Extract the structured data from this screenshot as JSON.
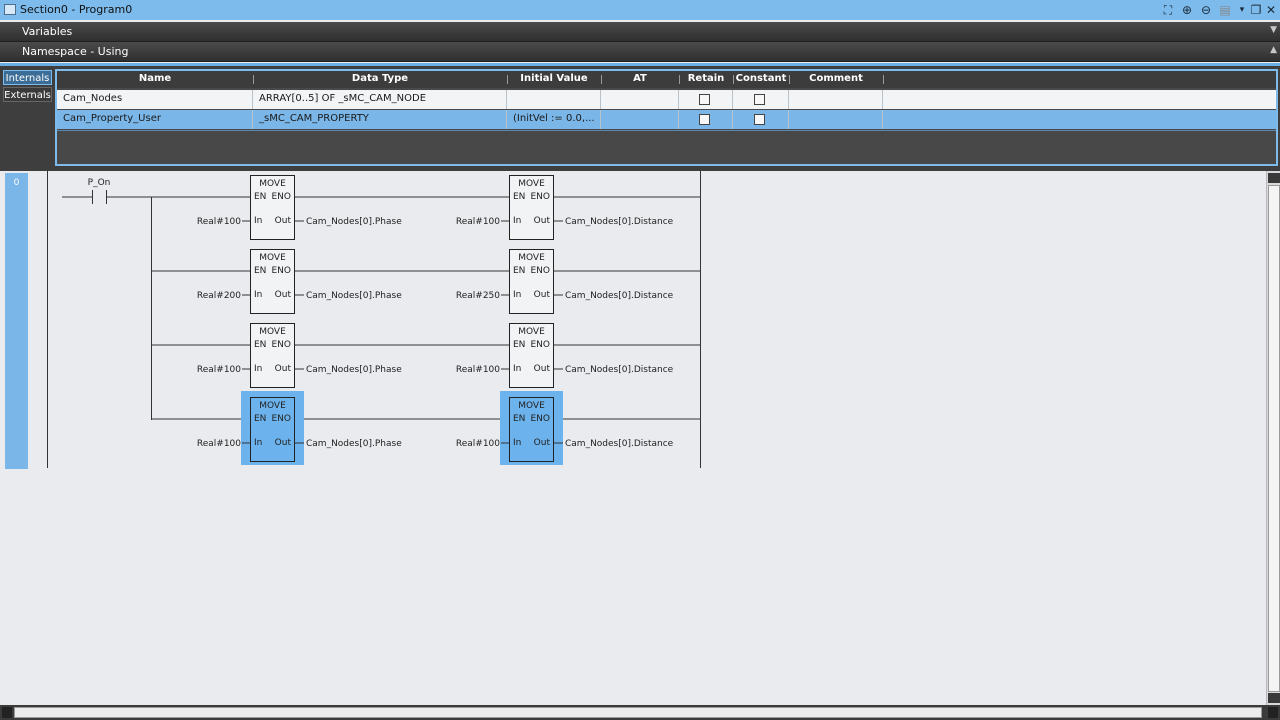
{
  "window": {
    "title": "Section0 - Program0",
    "buttons": {
      "fit": "⛶",
      "zoom_in": "⊕",
      "zoom_out": "⊖",
      "menu": "▾",
      "restore": "❐",
      "close": "✕"
    }
  },
  "variables_header": {
    "label": "Variables",
    "caret": "▼"
  },
  "namespace_header": {
    "label": "Namespace - Using",
    "caret": "▲"
  },
  "side_tabs": {
    "internals": "Internals",
    "externals": "Externals"
  },
  "columns": {
    "name": "Name",
    "data_type": "Data Type",
    "initial_value": "Initial Value",
    "at": "AT",
    "retain": "Retain",
    "constant": "Constant",
    "comment": "Comment"
  },
  "rows": [
    {
      "name": "Cam_Nodes",
      "data_type": "ARRAY[0..5] OF _sMC_CAM_NODE",
      "initial_value": "",
      "at": "",
      "retain": false,
      "constant": false,
      "comment": "",
      "selected": false
    },
    {
      "name": "Cam_Property_User",
      "data_type": "_sMC_CAM_PROPERTY",
      "initial_value": "(InitVel := 0.0,...",
      "at": "",
      "retain": false,
      "constant": false,
      "comment": "",
      "selected": true
    }
  ],
  "ladder": {
    "rung_number": "0",
    "contact_label": "P_On",
    "block_name": "MOVE",
    "pin_en": "EN",
    "pin_eno": "ENO",
    "pin_in": "In",
    "pin_out": "Out",
    "rows": [
      {
        "left_in": "Real#100",
        "left_out": "Cam_Nodes[0].Phase",
        "right_in": "Real#100",
        "right_out": "Cam_Nodes[0].Distance",
        "selected": false
      },
      {
        "left_in": "Real#200",
        "left_out": "Cam_Nodes[0].Phase",
        "right_in": "Real#250",
        "right_out": "Cam_Nodes[0].Distance",
        "selected": false
      },
      {
        "left_in": "Real#100",
        "left_out": "Cam_Nodes[0].Phase",
        "right_in": "Real#100",
        "right_out": "Cam_Nodes[0].Distance",
        "selected": false
      },
      {
        "left_in": "Real#100",
        "left_out": "Cam_Nodes[0].Phase",
        "right_in": "Real#100",
        "right_out": "Cam_Nodes[0].Distance",
        "selected": true
      }
    ]
  },
  "colors": {
    "accent": "#7ab6e8",
    "selection": "#6cb2ec",
    "dark": "#3e3e3e"
  }
}
